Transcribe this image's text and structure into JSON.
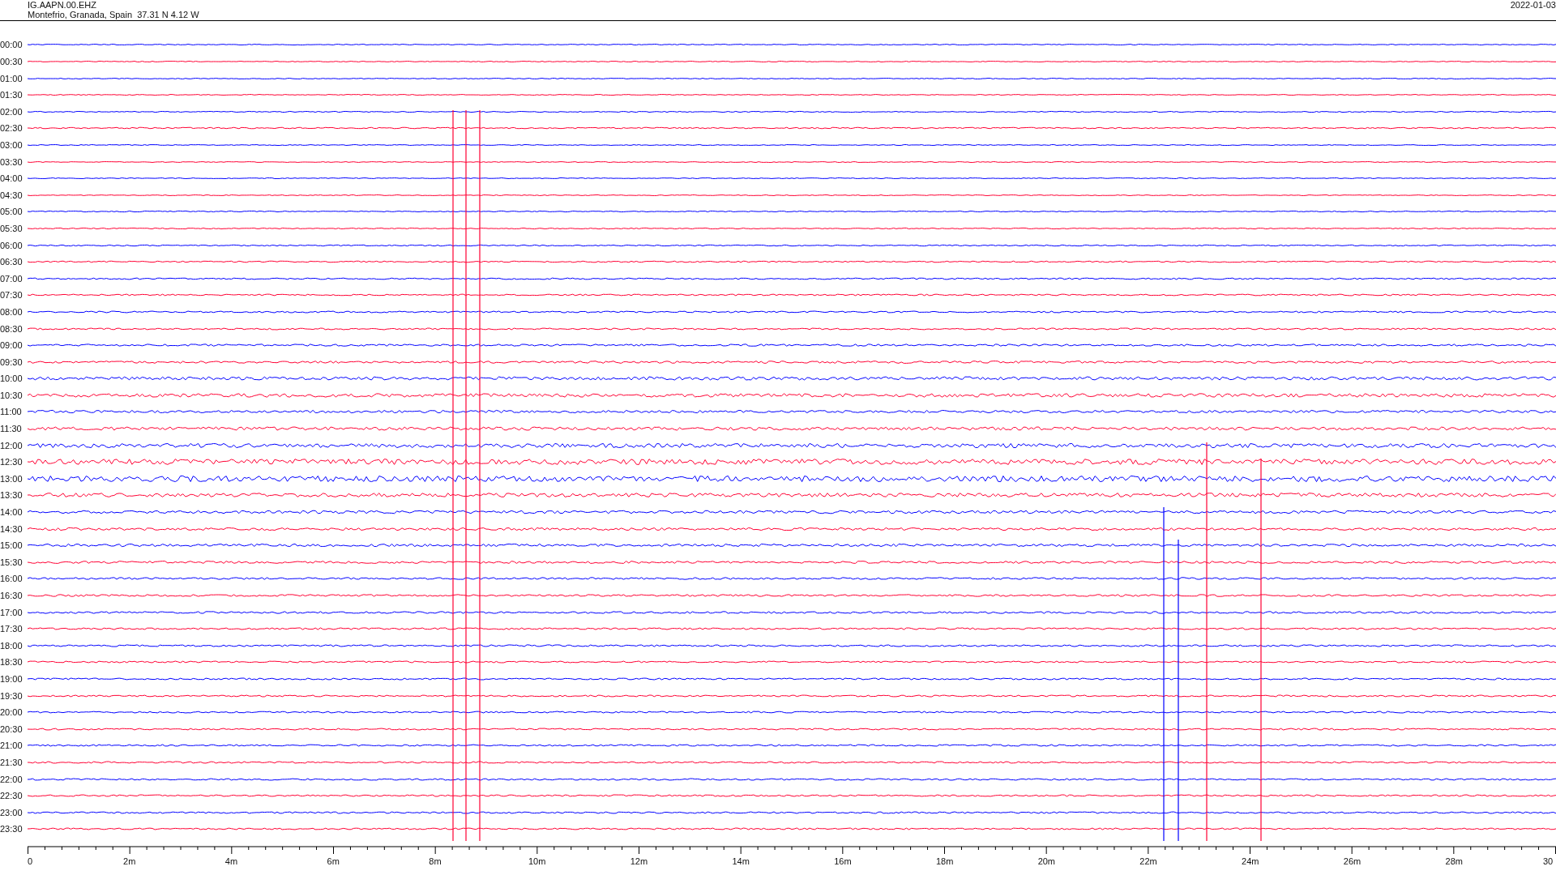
{
  "header": {
    "station": "IG.AAPN.00.EHZ",
    "location": "Montefrio, Granada, Spain  37.31 N 4.12 W",
    "date": "2022-01-03"
  },
  "traces": [
    {
      "time": "00:00",
      "color": "#0000ff"
    },
    {
      "time": "00:30",
      "color": "#ff0033"
    },
    {
      "time": "01:00",
      "color": "#0000ff"
    },
    {
      "time": "01:30",
      "color": "#ff0033"
    },
    {
      "time": "02:00",
      "color": "#0000ff"
    },
    {
      "time": "02:30",
      "color": "#ff0033"
    },
    {
      "time": "03:00",
      "color": "#0000ff"
    },
    {
      "time": "03:30",
      "color": "#ff0033"
    },
    {
      "time": "04:00",
      "color": "#0000ff"
    },
    {
      "time": "04:30",
      "color": "#ff0033"
    },
    {
      "time": "05:00",
      "color": "#0000ff"
    },
    {
      "time": "05:30",
      "color": "#ff0033"
    },
    {
      "time": "06:00",
      "color": "#0000ff"
    },
    {
      "time": "06:30",
      "color": "#ff0033"
    },
    {
      "time": "07:00",
      "color": "#0000ff"
    },
    {
      "time": "07:30",
      "color": "#ff0033"
    },
    {
      "time": "08:00",
      "color": "#0000ff"
    },
    {
      "time": "08:30",
      "color": "#ff0033"
    },
    {
      "time": "09:00",
      "color": "#0000ff"
    },
    {
      "time": "09:30",
      "color": "#ff0033"
    },
    {
      "time": "10:00",
      "color": "#0000ff"
    },
    {
      "time": "10:30",
      "color": "#ff0033"
    },
    {
      "time": "11:00",
      "color": "#0000ff"
    },
    {
      "time": "11:30",
      "color": "#ff0033"
    },
    {
      "time": "12:00",
      "color": "#0000ff"
    },
    {
      "time": "12:30",
      "color": "#ff0033"
    },
    {
      "time": "13:00",
      "color": "#0000ff"
    },
    {
      "time": "13:30",
      "color": "#ff0033"
    },
    {
      "time": "14:00",
      "color": "#0000ff"
    },
    {
      "time": "14:30",
      "color": "#ff0033"
    },
    {
      "time": "15:00",
      "color": "#0000ff"
    },
    {
      "time": "15:30",
      "color": "#ff0033"
    },
    {
      "time": "16:00",
      "color": "#0000ff"
    },
    {
      "time": "16:30",
      "color": "#ff0033"
    },
    {
      "time": "17:00",
      "color": "#0000ff"
    },
    {
      "time": "17:30",
      "color": "#ff0033"
    },
    {
      "time": "18:00",
      "color": "#0000ff"
    },
    {
      "time": "18:30",
      "color": "#ff0033"
    },
    {
      "time": "19:00",
      "color": "#0000ff"
    },
    {
      "time": "19:30",
      "color": "#ff0033"
    },
    {
      "time": "20:00",
      "color": "#0000ff"
    },
    {
      "time": "20:30",
      "color": "#ff0033"
    },
    {
      "time": "21:00",
      "color": "#0000ff"
    },
    {
      "time": "21:30",
      "color": "#ff0033"
    },
    {
      "time": "22:00",
      "color": "#0000ff"
    },
    {
      "time": "22:30",
      "color": "#ff0033"
    },
    {
      "time": "23:00",
      "color": "#0000ff"
    },
    {
      "time": "23:30",
      "color": "#ff0033"
    }
  ],
  "x_axis": {
    "ticks": [
      "0",
      "2m",
      "4m",
      "6m",
      "8m",
      "10m",
      "12m",
      "14m",
      "16m",
      "18m",
      "20m",
      "22m",
      "24m",
      "26m",
      "28m",
      "30"
    ]
  }
}
